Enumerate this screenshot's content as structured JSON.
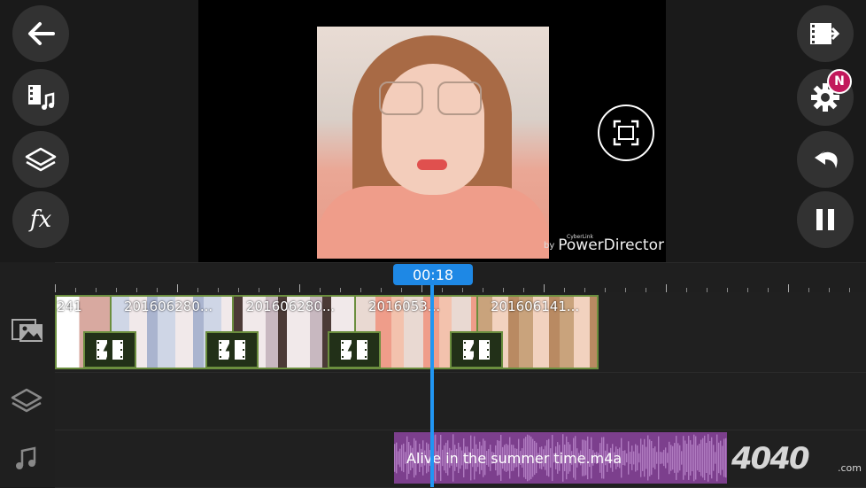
{
  "left_toolbar": {
    "items": [
      {
        "name": "back-arrow-icon"
      },
      {
        "name": "media-music-icon"
      },
      {
        "name": "layers-icon"
      },
      {
        "name": "fx-icon",
        "label": "fx"
      }
    ]
  },
  "right_toolbar": {
    "items": [
      {
        "name": "produce-export-icon"
      },
      {
        "name": "settings-gear-icon",
        "badge": "N"
      },
      {
        "name": "undo-icon"
      },
      {
        "name": "pause-icon"
      }
    ]
  },
  "preview": {
    "watermark_by": "by",
    "watermark_brand": "PowerDirector",
    "watermark_small": "CyberLink"
  },
  "timeline": {
    "current_time": "00:18",
    "clips": [
      {
        "label": "241"
      },
      {
        "label": "201606280..."
      },
      {
        "label": "201606280..."
      },
      {
        "label": "2016053..."
      },
      {
        "label": "201606141..."
      }
    ],
    "audio": {
      "label": "Alive in the summer time.m4a"
    }
  },
  "overlay_logo": {
    "text": "4040",
    "suffix": ".com"
  },
  "colors": {
    "accent": "#1e88e5",
    "clip_border": "#6b8e3e",
    "audio": "#7c3f8d",
    "badge": "#c2185b"
  }
}
